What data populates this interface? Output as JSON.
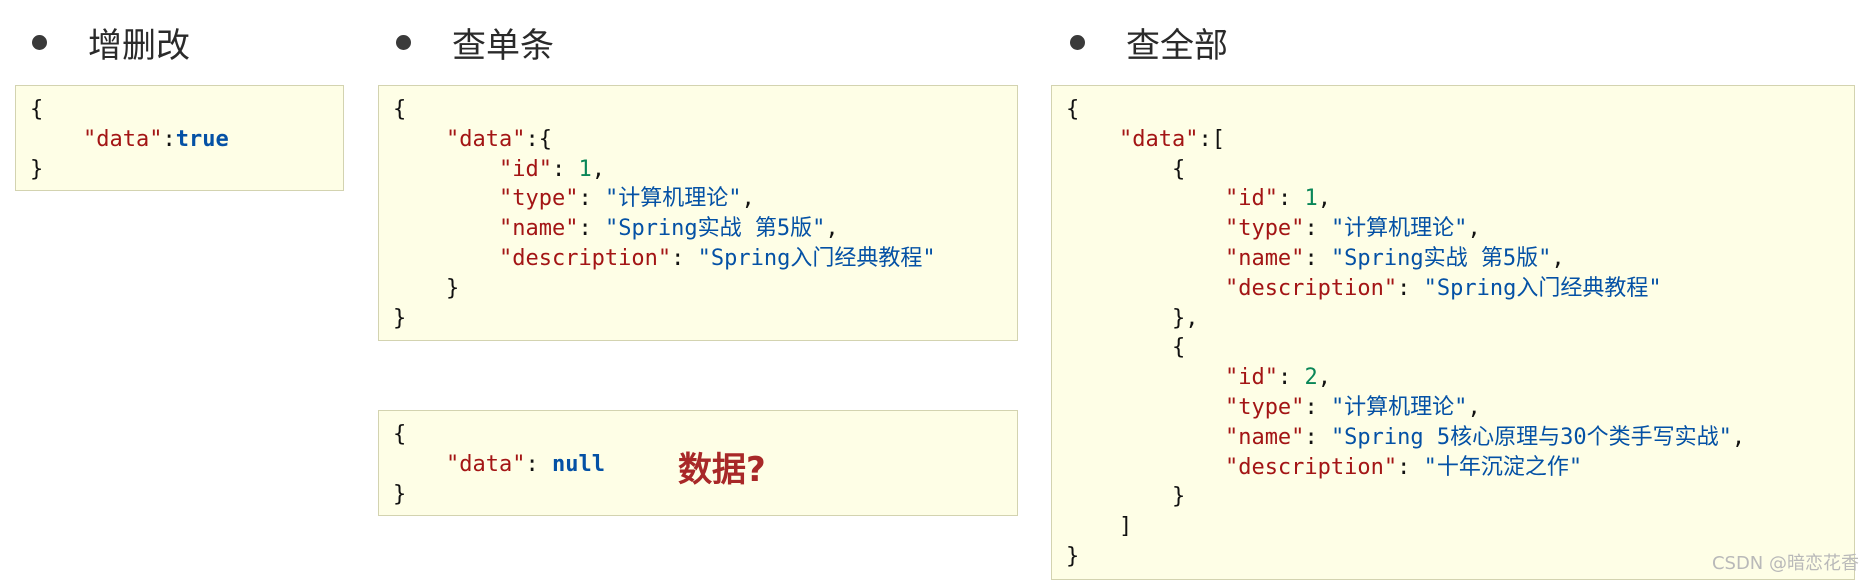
{
  "headings": {
    "crud": "增删改",
    "get_one": "查单条",
    "get_all": "查全部"
  },
  "json_keys": {
    "data": "\"data\"",
    "id": "\"id\"",
    "type": "\"type\"",
    "name": "\"name\"",
    "description": "\"description\""
  },
  "box_crud": {
    "data_value": "true"
  },
  "box_get_one": {
    "id": "1",
    "type": "\"计算机理论\"",
    "name": "\"Spring实战 第5版\"",
    "description": "\"Spring入门经典教程\""
  },
  "box_null": {
    "data_value": "null"
  },
  "callout": "数据?",
  "box_get_all": {
    "items": [
      {
        "id": "1",
        "type": "\"计算机理论\"",
        "name": "\"Spring实战 第5版\"",
        "description": "\"Spring入门经典教程\""
      },
      {
        "id": "2",
        "type": "\"计算机理论\"",
        "name": "\"Spring 5核心原理与30个类手写实战\"",
        "description": "\"十年沉淀之作\""
      }
    ]
  },
  "watermark": "CSDN @暗恋花香",
  "colors": {
    "key": "#a31515",
    "string": "#0451a5",
    "number": "#098658",
    "callout": "#a82828",
    "box_background": "#fefee6"
  }
}
